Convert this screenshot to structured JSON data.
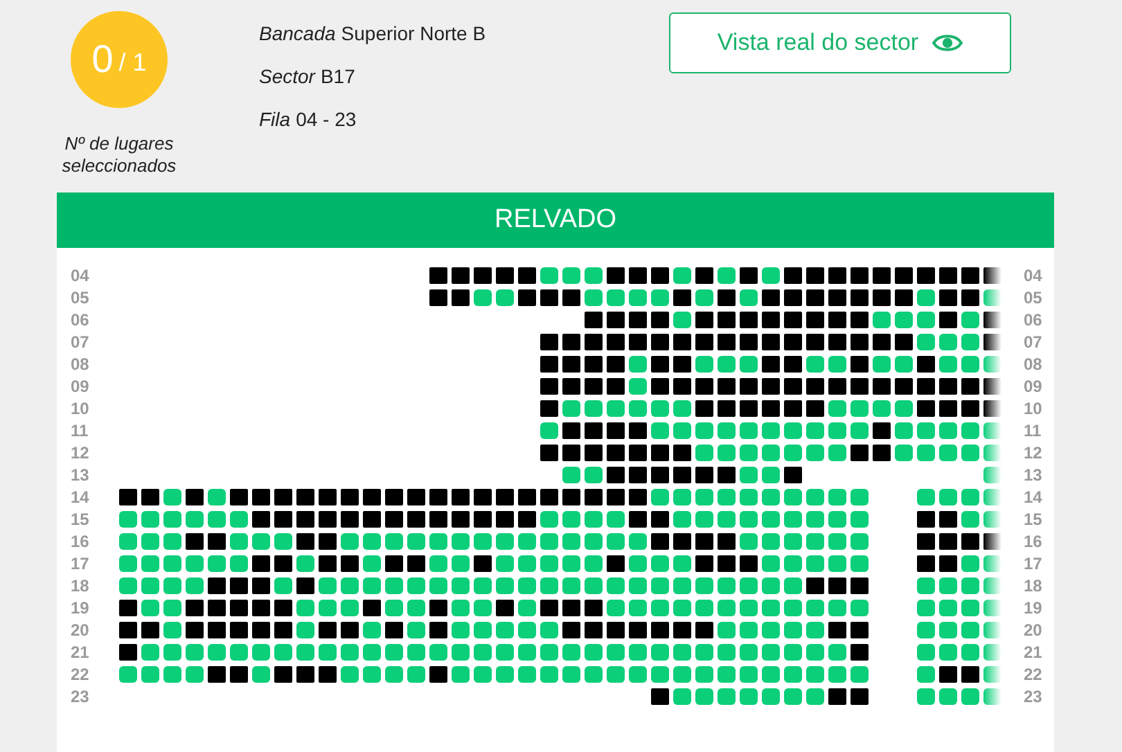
{
  "counter": {
    "selected": "0",
    "total": "/ 1",
    "caption": "Nº de lugares seleccionados"
  },
  "info": [
    {
      "label": "Bancada",
      "value": "Superior Norte B"
    },
    {
      "label": "Sector",
      "value": "B17"
    },
    {
      "label": "Fila",
      "value": "04 - 23"
    }
  ],
  "view_button": {
    "label": "Vista real do sector"
  },
  "pitch_banner": "RELVADO",
  "rows": [
    {
      "left_label": "04",
      "right_label": "04",
      "seat_present": [
        false,
        false,
        false,
        false,
        false,
        false,
        false,
        false,
        false,
        false,
        false,
        false,
        false,
        false,
        true,
        true,
        true,
        true,
        true,
        true,
        true,
        true,
        true,
        true,
        true,
        true,
        true,
        true,
        true,
        true,
        true,
        true,
        true,
        true,
        true,
        true,
        true,
        true,
        true,
        true
      ],
      "taken": [
        true,
        true,
        true,
        true,
        true,
        false,
        false,
        false,
        true,
        true,
        true,
        false,
        true,
        false,
        true,
        false,
        true,
        true,
        true,
        true,
        true,
        true,
        true,
        true,
        true,
        true
      ]
    },
    {
      "left_label": "05",
      "right_label": "05",
      "seat_present": [
        false,
        false,
        false,
        false,
        false,
        false,
        false,
        false,
        false,
        false,
        false,
        false,
        false,
        false,
        true,
        true,
        true,
        true,
        true,
        true,
        true,
        true,
        true,
        true,
        true,
        true,
        true,
        true,
        true,
        true,
        true,
        true,
        true,
        true,
        true,
        true,
        true,
        true,
        true,
        true
      ],
      "taken": [
        true,
        true,
        false,
        false,
        true,
        true,
        true,
        false,
        false,
        false,
        false,
        true,
        false,
        true,
        false,
        true,
        true,
        true,
        true,
        true,
        true,
        true,
        false,
        true,
        true,
        false
      ]
    },
    {
      "left_label": "06",
      "right_label": "06",
      "seat_present": [
        false,
        false,
        false,
        false,
        false,
        false,
        false,
        false,
        false,
        false,
        false,
        false,
        false,
        false,
        false,
        false,
        false,
        false,
        false,
        false,
        false,
        true,
        true,
        true,
        true,
        true,
        true,
        true,
        true,
        true,
        true,
        true,
        true,
        true,
        true,
        true,
        true,
        true,
        true,
        true
      ],
      "taken": [
        true,
        true,
        true,
        true,
        false,
        true,
        true,
        true,
        true,
        true,
        true,
        true,
        true,
        false,
        false,
        false,
        true,
        false,
        true
      ]
    },
    {
      "left_label": "07",
      "right_label": "07",
      "seat_present": [
        false,
        false,
        false,
        false,
        false,
        false,
        false,
        false,
        false,
        false,
        false,
        false,
        false,
        false,
        false,
        false,
        false,
        false,
        false,
        true,
        true,
        true,
        true,
        true,
        true,
        true,
        true,
        true,
        true,
        true,
        true,
        true,
        true,
        true,
        true,
        true,
        true,
        true,
        true,
        true
      ],
      "taken": [
        true,
        true,
        true,
        true,
        true,
        true,
        true,
        true,
        true,
        true,
        true,
        true,
        true,
        true,
        true,
        true,
        true,
        false,
        false,
        false,
        true
      ]
    },
    {
      "left_label": "08",
      "right_label": "08",
      "seat_present": [
        false,
        false,
        false,
        false,
        false,
        false,
        false,
        false,
        false,
        false,
        false,
        false,
        false,
        false,
        false,
        false,
        false,
        false,
        false,
        true,
        true,
        true,
        true,
        true,
        true,
        true,
        true,
        true,
        true,
        true,
        true,
        true,
        true,
        true,
        true,
        true,
        true,
        true,
        true,
        true
      ],
      "taken": [
        true,
        true,
        true,
        true,
        false,
        true,
        true,
        false,
        false,
        false,
        true,
        true,
        false,
        false,
        true,
        false,
        false,
        true,
        false,
        false,
        false
      ]
    },
    {
      "left_label": "09",
      "right_label": "09",
      "seat_present": [
        false,
        false,
        false,
        false,
        false,
        false,
        false,
        false,
        false,
        false,
        false,
        false,
        false,
        false,
        false,
        false,
        false,
        false,
        false,
        true,
        true,
        true,
        true,
        true,
        true,
        true,
        true,
        true,
        true,
        true,
        true,
        true,
        true,
        true,
        true,
        true,
        true,
        true,
        true,
        true
      ],
      "taken": [
        true,
        true,
        true,
        true,
        false,
        true,
        true,
        true,
        true,
        true,
        true,
        true,
        true,
        true,
        true,
        true,
        true,
        true,
        true,
        true,
        true
      ]
    },
    {
      "left_label": "10",
      "right_label": "10",
      "seat_present": [
        false,
        false,
        false,
        false,
        false,
        false,
        false,
        false,
        false,
        false,
        false,
        false,
        false,
        false,
        false,
        false,
        false,
        false,
        false,
        true,
        true,
        true,
        true,
        true,
        true,
        true,
        true,
        true,
        true,
        true,
        true,
        true,
        true,
        true,
        true,
        true,
        true,
        true,
        true,
        true
      ],
      "taken": [
        true,
        false,
        false,
        false,
        false,
        false,
        false,
        true,
        true,
        true,
        true,
        true,
        true,
        false,
        false,
        false,
        false,
        true,
        true,
        true,
        true
      ]
    },
    {
      "left_label": "11",
      "right_label": "11",
      "seat_present": [
        false,
        false,
        false,
        false,
        false,
        false,
        false,
        false,
        false,
        false,
        false,
        false,
        false,
        false,
        false,
        false,
        false,
        false,
        false,
        true,
        true,
        true,
        true,
        true,
        true,
        true,
        true,
        true,
        true,
        true,
        true,
        true,
        true,
        true,
        true,
        true,
        true,
        true,
        true,
        true
      ],
      "taken": [
        false,
        true,
        true,
        true,
        true,
        false,
        false,
        false,
        false,
        false,
        false,
        false,
        false,
        false,
        false,
        true,
        false,
        false,
        false,
        false,
        false
      ]
    },
    {
      "left_label": "12",
      "right_label": "12",
      "seat_present": [
        false,
        false,
        false,
        false,
        false,
        false,
        false,
        false,
        false,
        false,
        false,
        false,
        false,
        false,
        false,
        false,
        false,
        false,
        false,
        true,
        true,
        true,
        true,
        true,
        true,
        true,
        true,
        true,
        true,
        true,
        true,
        true,
        true,
        true,
        true,
        true,
        true,
        true,
        true,
        true
      ],
      "taken": [
        true,
        true,
        true,
        true,
        true,
        true,
        true,
        false,
        false,
        false,
        false,
        false,
        false,
        false,
        true,
        true,
        false,
        false,
        false,
        false,
        false
      ]
    },
    {
      "left_label": "13",
      "right_label": "13",
      "seat_present": [
        false,
        false,
        false,
        false,
        false,
        false,
        false,
        false,
        false,
        false,
        false,
        false,
        false,
        false,
        false,
        false,
        false,
        false,
        false,
        false,
        true,
        true,
        true,
        true,
        true,
        true,
        true,
        true,
        true,
        true,
        true,
        false,
        false,
        false,
        false,
        false,
        false,
        false,
        false,
        true
      ],
      "taken": [
        false,
        false,
        true,
        true,
        true,
        true,
        true,
        true,
        false,
        false,
        true,
        false
      ]
    },
    {
      "left_label": "14",
      "right_label": "14",
      "seat_present": [
        true,
        true,
        true,
        true,
        true,
        true,
        true,
        true,
        true,
        true,
        true,
        true,
        true,
        true,
        true,
        true,
        true,
        true,
        true,
        true,
        true,
        true,
        true,
        true,
        true,
        true,
        true,
        true,
        true,
        true,
        true,
        true,
        true,
        true,
        false,
        false,
        true,
        true,
        true,
        true
      ],
      "taken": [
        true,
        true,
        false,
        true,
        false,
        true,
        true,
        true,
        true,
        true,
        true,
        true,
        true,
        true,
        true,
        true,
        true,
        true,
        true,
        true,
        true,
        true,
        true,
        true,
        false,
        false,
        false,
        false,
        false,
        false,
        false,
        false,
        false,
        false,
        false,
        false,
        false,
        false
      ]
    },
    {
      "left_label": "15",
      "right_label": "15",
      "seat_present": [
        true,
        true,
        true,
        true,
        true,
        true,
        true,
        true,
        true,
        true,
        true,
        true,
        true,
        true,
        true,
        true,
        true,
        true,
        true,
        true,
        true,
        true,
        true,
        true,
        true,
        true,
        true,
        true,
        true,
        true,
        true,
        true,
        true,
        true,
        false,
        false,
        true,
        true,
        true,
        true
      ],
      "taken": [
        false,
        false,
        false,
        false,
        false,
        false,
        true,
        true,
        true,
        true,
        true,
        true,
        true,
        true,
        true,
        true,
        true,
        true,
        true,
        false,
        false,
        false,
        false,
        true,
        true,
        false,
        false,
        false,
        false,
        false,
        false,
        false,
        false,
        false,
        true,
        true,
        false,
        false
      ]
    },
    {
      "left_label": "16",
      "right_label": "16",
      "seat_present": [
        true,
        true,
        true,
        true,
        true,
        true,
        true,
        true,
        true,
        true,
        true,
        true,
        true,
        true,
        true,
        true,
        true,
        true,
        true,
        true,
        true,
        true,
        true,
        true,
        true,
        true,
        true,
        true,
        true,
        true,
        true,
        true,
        true,
        true,
        false,
        false,
        true,
        true,
        true,
        true
      ],
      "taken": [
        false,
        false,
        false,
        true,
        true,
        false,
        false,
        false,
        true,
        true,
        false,
        false,
        false,
        false,
        false,
        false,
        false,
        false,
        false,
        false,
        false,
        false,
        false,
        false,
        true,
        true,
        true,
        true,
        false,
        false,
        false,
        false,
        false,
        false,
        true,
        true,
        true,
        true
      ]
    },
    {
      "left_label": "17",
      "right_label": "17",
      "seat_present": [
        true,
        true,
        true,
        true,
        true,
        true,
        true,
        true,
        true,
        true,
        true,
        true,
        true,
        true,
        true,
        true,
        true,
        true,
        true,
        true,
        true,
        true,
        true,
        true,
        true,
        true,
        true,
        true,
        true,
        true,
        true,
        true,
        true,
        true,
        false,
        false,
        true,
        true,
        true,
        true
      ],
      "taken": [
        false,
        false,
        false,
        false,
        false,
        false,
        true,
        true,
        false,
        true,
        true,
        false,
        true,
        true,
        false,
        false,
        true,
        false,
        false,
        false,
        false,
        false,
        true,
        false,
        false,
        false,
        true,
        true,
        true,
        false,
        false,
        false,
        false,
        false,
        true,
        true,
        false,
        false
      ]
    },
    {
      "left_label": "18",
      "right_label": "18",
      "seat_present": [
        true,
        true,
        true,
        true,
        true,
        true,
        true,
        true,
        true,
        true,
        true,
        true,
        true,
        true,
        true,
        true,
        true,
        true,
        true,
        true,
        true,
        true,
        true,
        true,
        true,
        true,
        true,
        true,
        true,
        true,
        true,
        true,
        true,
        true,
        false,
        false,
        true,
        true,
        true,
        true
      ],
      "taken": [
        false,
        false,
        false,
        false,
        true,
        true,
        true,
        false,
        true,
        false,
        false,
        false,
        false,
        false,
        false,
        false,
        false,
        false,
        false,
        false,
        false,
        false,
        false,
        false,
        false,
        false,
        false,
        false,
        false,
        false,
        false,
        true,
        true,
        true,
        false,
        false,
        false,
        false
      ]
    },
    {
      "left_label": "19",
      "right_label": "19",
      "seat_present": [
        true,
        true,
        true,
        true,
        true,
        true,
        true,
        true,
        true,
        true,
        true,
        true,
        true,
        true,
        true,
        true,
        true,
        true,
        true,
        true,
        true,
        true,
        true,
        true,
        true,
        true,
        true,
        true,
        true,
        true,
        true,
        true,
        true,
        true,
        false,
        false,
        true,
        true,
        true,
        true
      ],
      "taken": [
        true,
        false,
        false,
        true,
        true,
        true,
        true,
        true,
        false,
        false,
        false,
        true,
        false,
        false,
        true,
        false,
        false,
        true,
        false,
        true,
        true,
        true,
        false,
        false,
        false,
        false,
        false,
        false,
        false,
        false,
        false,
        false,
        false,
        false,
        false,
        false,
        false,
        false
      ]
    },
    {
      "left_label": "20",
      "right_label": "20",
      "seat_present": [
        true,
        true,
        true,
        true,
        true,
        true,
        true,
        true,
        true,
        true,
        true,
        true,
        true,
        true,
        true,
        true,
        true,
        true,
        true,
        true,
        true,
        true,
        true,
        true,
        true,
        true,
        true,
        true,
        true,
        true,
        true,
        true,
        true,
        true,
        false,
        false,
        true,
        true,
        true,
        true
      ],
      "taken": [
        true,
        true,
        false,
        true,
        true,
        true,
        true,
        true,
        false,
        true,
        true,
        false,
        true,
        false,
        true,
        false,
        false,
        false,
        false,
        false,
        true,
        true,
        true,
        true,
        true,
        true,
        true,
        false,
        false,
        false,
        false,
        false,
        true,
        true,
        false,
        false,
        false,
        false
      ]
    },
    {
      "left_label": "21",
      "right_label": "21",
      "seat_present": [
        true,
        true,
        true,
        true,
        true,
        true,
        true,
        true,
        true,
        true,
        true,
        true,
        true,
        true,
        true,
        true,
        true,
        true,
        true,
        true,
        true,
        true,
        true,
        true,
        true,
        true,
        true,
        true,
        true,
        true,
        true,
        true,
        true,
        true,
        false,
        false,
        true,
        true,
        true,
        true
      ],
      "taken": [
        true,
        false,
        false,
        false,
        false,
        false,
        false,
        false,
        false,
        false,
        false,
        false,
        false,
        false,
        false,
        false,
        false,
        false,
        false,
        false,
        false,
        false,
        false,
        false,
        false,
        false,
        false,
        false,
        false,
        false,
        false,
        false,
        false,
        true,
        false,
        false,
        false,
        false
      ]
    },
    {
      "left_label": "22",
      "right_label": "22",
      "seat_present": [
        true,
        true,
        true,
        true,
        true,
        true,
        true,
        true,
        true,
        true,
        true,
        true,
        true,
        true,
        true,
        true,
        true,
        true,
        true,
        true,
        true,
        true,
        true,
        true,
        true,
        true,
        true,
        true,
        true,
        true,
        true,
        true,
        true,
        true,
        false,
        false,
        true,
        true,
        true,
        true
      ],
      "taken": [
        false,
        false,
        false,
        false,
        true,
        true,
        false,
        true,
        true,
        true,
        false,
        false,
        false,
        false,
        true,
        false,
        false,
        false,
        false,
        false,
        false,
        false,
        false,
        false,
        false,
        false,
        false,
        false,
        false,
        false,
        false,
        false,
        false,
        false,
        false,
        true,
        true,
        false
      ]
    },
    {
      "left_label": "23",
      "right_label": "23",
      "seat_present": [
        false,
        false,
        false,
        false,
        false,
        false,
        false,
        false,
        false,
        false,
        false,
        false,
        false,
        false,
        false,
        false,
        false,
        false,
        false,
        false,
        false,
        false,
        false,
        false,
        true,
        true,
        true,
        true,
        true,
        true,
        true,
        true,
        true,
        true,
        false,
        false,
        true,
        true,
        true,
        true
      ],
      "taken": [
        true,
        false,
        false,
        false,
        false,
        false,
        false,
        false,
        true,
        true,
        false,
        false,
        false,
        false
      ]
    }
  ]
}
